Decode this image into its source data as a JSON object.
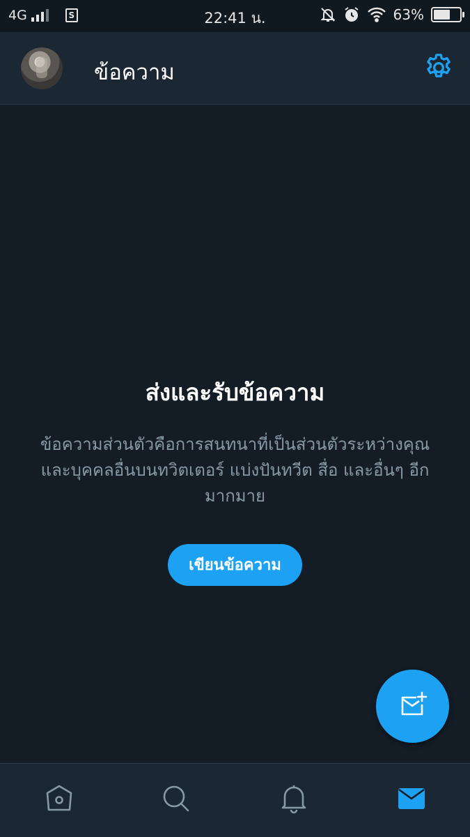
{
  "status_bar": {
    "network": "4G",
    "time": "22:41 น.",
    "battery": "63%",
    "battery_level": 0.63,
    "icons": [
      "signal-icon",
      "sim-icon",
      "notification-off-icon",
      "alarm-icon",
      "wifi-icon",
      "battery-icon"
    ]
  },
  "header": {
    "title": "ข้อความ",
    "avatar_icon": "avatar",
    "settings_icon": "gear-icon"
  },
  "empty_state": {
    "title": "ส่งและรับข้อความ",
    "description": "ข้อความส่วนตัวคือการสนทนาที่เป็นส่วนตัวระหว่างคุณและบุคคลอื่นบนทวิตเตอร์ แบ่งปันทวีต สื่อ และอื่นๆ อีกมากมาย",
    "button_label": "เขียนข้อความ"
  },
  "fab": {
    "icon": "new-message-icon"
  },
  "bottom_nav": {
    "items": [
      {
        "icon": "home-icon",
        "active": false
      },
      {
        "icon": "search-icon",
        "active": false
      },
      {
        "icon": "bell-icon",
        "active": false
      },
      {
        "icon": "mail-icon",
        "active": true
      }
    ]
  },
  "colors": {
    "accent": "#1da1f2",
    "background": "#141d26",
    "header_background": "#1b2733",
    "secondary_text": "#8899a6"
  }
}
